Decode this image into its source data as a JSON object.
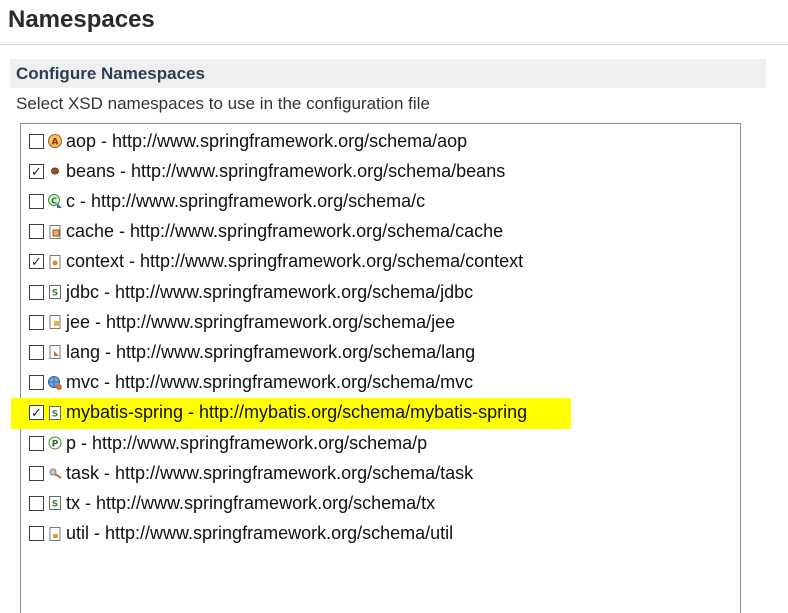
{
  "page": {
    "title": "Namespaces"
  },
  "section": {
    "title": "Configure Namespaces",
    "description": "Select XSD namespaces to use in the configuration file"
  },
  "colors": {
    "highlight": "#ffff00"
  },
  "namespaces": [
    {
      "label": "aop - http://www.springframework.org/schema/aop",
      "checked": false,
      "icon": "aop-icon"
    },
    {
      "label": "beans - http://www.springframework.org/schema/beans",
      "checked": true,
      "icon": "bean-icon"
    },
    {
      "label": "c - http://www.springframework.org/schema/c",
      "checked": false,
      "icon": "c-namespace-icon"
    },
    {
      "label": "cache - http://www.springframework.org/schema/cache",
      "checked": false,
      "icon": "cache-icon"
    },
    {
      "label": "context - http://www.springframework.org/schema/context",
      "checked": true,
      "icon": "context-icon"
    },
    {
      "label": "jdbc - http://www.springframework.org/schema/jdbc",
      "checked": false,
      "icon": "spring-s-icon"
    },
    {
      "label": "jee - http://www.springframework.org/schema/jee",
      "checked": false,
      "icon": "jee-icon"
    },
    {
      "label": "lang - http://www.springframework.org/schema/lang",
      "checked": false,
      "icon": "lang-icon"
    },
    {
      "label": "mvc - http://www.springframework.org/schema/mvc",
      "checked": false,
      "icon": "mvc-globe-icon"
    },
    {
      "label": "mybatis-spring - http://mybatis.org/schema/mybatis-spring",
      "checked": true,
      "icon": "spring-s-icon",
      "highlighted": true
    },
    {
      "label": "p - http://www.springframework.org/schema/p",
      "checked": false,
      "icon": "p-namespace-icon"
    },
    {
      "label": "task - http://www.springframework.org/schema/task",
      "checked": false,
      "icon": "task-icon"
    },
    {
      "label": "tx - http://www.springframework.org/schema/tx",
      "checked": false,
      "icon": "spring-s-icon"
    },
    {
      "label": "util - http://www.springframework.org/schema/util",
      "checked": false,
      "icon": "util-icon"
    }
  ]
}
